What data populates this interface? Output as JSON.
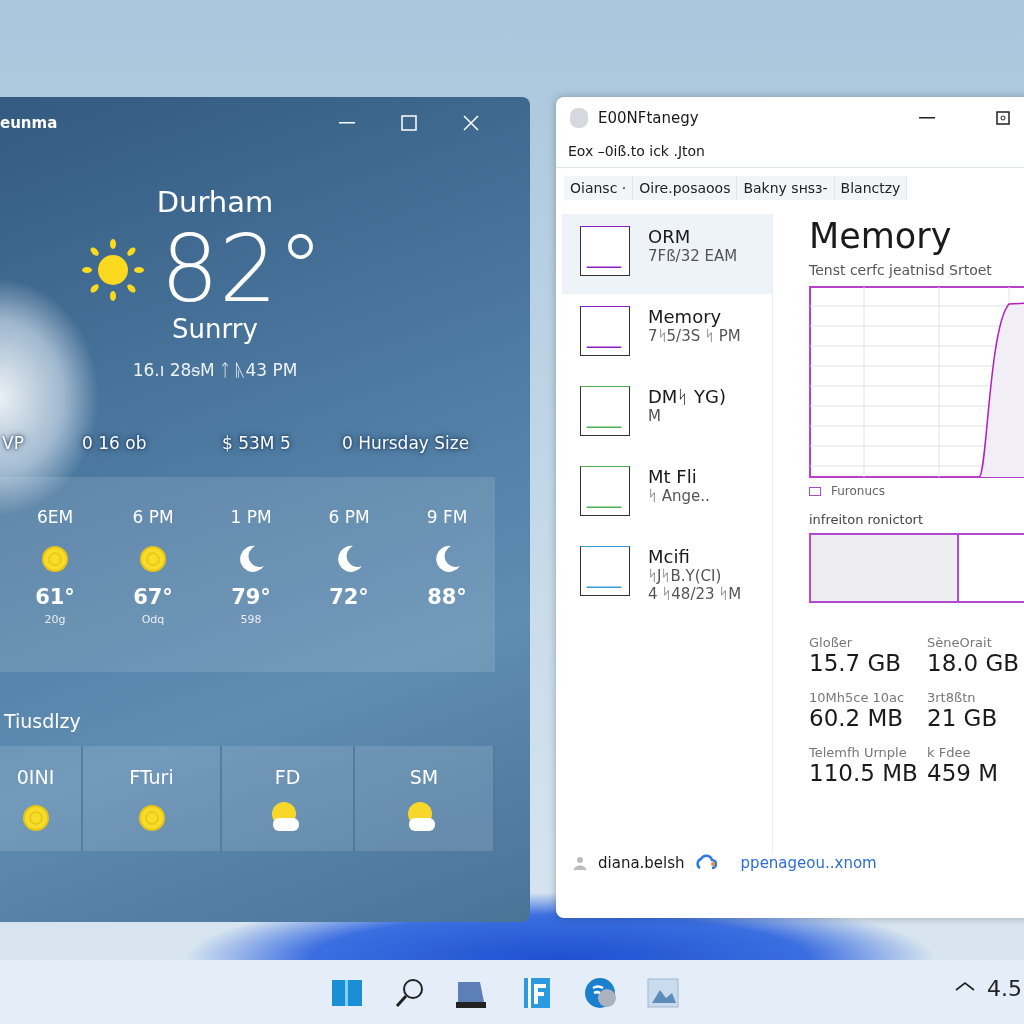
{
  "weather_window": {
    "title": "eunma",
    "city": "Durham",
    "temperature": "82°",
    "condition": "Sunrry",
    "updated": "16.ı 28ᵴM ᛏ ᚣ43 PM",
    "stats": [
      "VP",
      "0 16 ob",
      "$  53M 5",
      "0  Hursday Size"
    ],
    "hourly": [
      {
        "time": "6EM",
        "kind": "sun",
        "temp": "61°",
        "note": "20g"
      },
      {
        "time": "6 PM",
        "kind": "sun",
        "temp": "67°",
        "note": "Odq"
      },
      {
        "time": "1 PM",
        "kind": "moon",
        "temp": "79°",
        "note": "598"
      },
      {
        "time": "6 PM",
        "kind": "moon",
        "temp": "72°"
      },
      {
        "time": "9 FM",
        "kind": "moon",
        "temp": "88°"
      }
    ],
    "day_heading": "Tiusdlzy",
    "daily": [
      {
        "label": "0INI",
        "kind": "sun"
      },
      {
        "label": "FTuri",
        "kind": "sun"
      },
      {
        "label": "FD",
        "kind": "partly-cloudy"
      },
      {
        "label": "SM",
        "kind": "partly-cloudy"
      }
    ]
  },
  "task_manager": {
    "title": "E00NFtanegy",
    "menu": "Eox  –0iß.to ick .Jton",
    "tabs": [
      {
        "label": "Oiansc ·",
        "selected": false
      },
      {
        "label": "Oire.posaoos",
        "selected": false
      },
      {
        "label": "Bakny sнsз-",
        "selected": false
      },
      {
        "label": "Blanctzy",
        "selected": false
      }
    ],
    "sidebar": [
      {
        "name": "ORM",
        "lines": [
          "7Fß/32 EAM"
        ],
        "color": "#8a1fc4",
        "selected": true
      },
      {
        "name": "Memory",
        "lines": [
          "7ᛋ5/3S ᛋ PM"
        ],
        "color": "#8a1fc4",
        "selected": false
      },
      {
        "name": "DMᛋ YG)",
        "lines": [
          "M"
        ],
        "color": "#4caf50",
        "selected": false
      },
      {
        "name": "Mt Fli",
        "lines": [
          "ᛋ Ange.."
        ],
        "color": "#4caf50",
        "selected": false
      },
      {
        "name": "Mcifi",
        "lines": [
          "ᛋJᛋB.Y(CI)",
          "4 ᛋ48/23 ᛋM"
        ],
        "color": "#3a9bd6",
        "selected": false
      }
    ],
    "heading": "Memory",
    "subtitle": "Tenst cerfc jeatnisd Srtoet",
    "legend": "Furonucs",
    "composition_label": "infreiton ronictort",
    "composition": {
      "level": 0.62
    },
    "stats": [
      {
        "label": "Gloßer",
        "value": "15.7 GB"
      },
      {
        "label": "SèneOrait",
        "value": "18.0 GB"
      },
      {
        "label": "10Mh5ce 10ac",
        "value": "60.2 MB"
      },
      {
        "label": "3rt8ßtn",
        "value": "21 GB"
      },
      {
        "label": "Telemfh Urnple",
        "value": "110.5 MB"
      },
      {
        "label": "k Fdee",
        "value": "459 M"
      }
    ],
    "footer": {
      "user": "diana.belsh",
      "link": "ppenageou..xnom"
    }
  },
  "taskbar": {
    "clock": "4.5"
  }
}
